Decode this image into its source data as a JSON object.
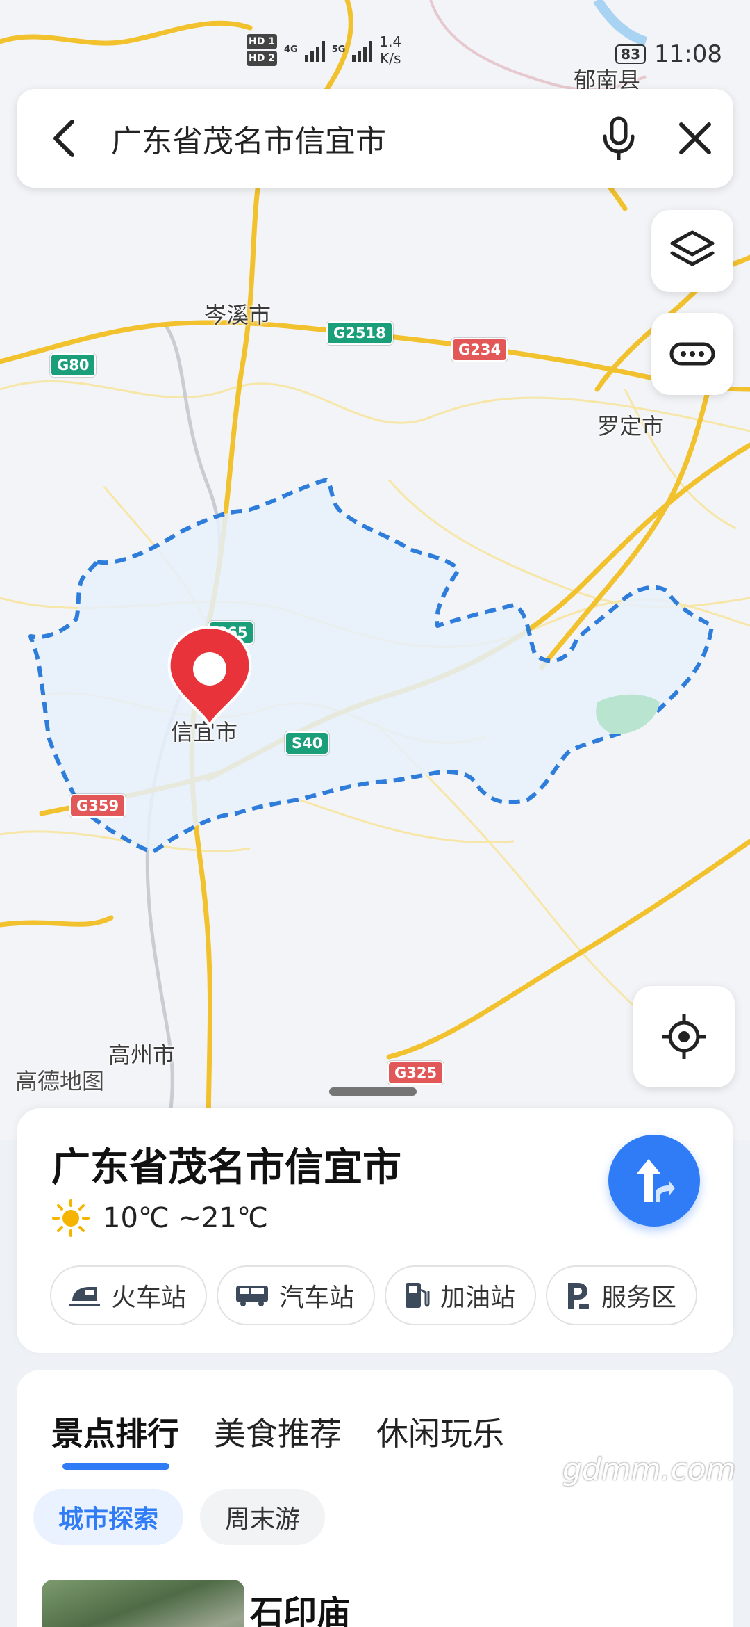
{
  "status_bar": {
    "hd1": "HD 1",
    "hd2": "HD 2",
    "net1": "4G",
    "net2": "5G",
    "speed_value": "1.4",
    "speed_unit": "K/s",
    "battery": "83",
    "time": "11:08"
  },
  "search": {
    "query": "广东省茂名市信宜市",
    "back_icon": "back-arrow-icon",
    "mic_icon": "microphone-icon",
    "close_icon": "close-icon"
  },
  "map": {
    "places": {
      "yunan": "郁南县",
      "cenxi": "岑溪市",
      "luoding": "罗定市",
      "xinyi": "信宜市",
      "gaozhou": "高州市"
    },
    "roads": {
      "g2518": "G2518",
      "g234": "G234",
      "g80": "G80",
      "g65": "G65",
      "s40": "S40",
      "g359": "G359",
      "g325": "G325"
    },
    "provider_logo": "高德地图",
    "layers_icon": "layers-icon",
    "more_icon": "more-icon",
    "locate_icon": "locate-icon",
    "marker_icon": "location-pin-icon"
  },
  "info_card": {
    "title": "广东省茂名市信宜市",
    "weather_icon": "sun-icon",
    "temperature": "10℃ ~21℃",
    "navigate_icon": "navigate-icon",
    "chips": [
      {
        "label": "火车站",
        "icon": "train-icon"
      },
      {
        "label": "汽车站",
        "icon": "bus-icon"
      },
      {
        "label": "加油站",
        "icon": "gas-station-icon"
      },
      {
        "label": "服务区",
        "icon": "service-area-icon"
      }
    ]
  },
  "explore": {
    "tabs": [
      "景点排行",
      "美食推荐",
      "休闲玩乐"
    ],
    "active_tab": 0,
    "subtabs": [
      "城市探索",
      "周末游"
    ],
    "active_subtab": 0,
    "first_item": {
      "name": "石印庙"
    }
  },
  "watermark": "gdmm.com",
  "colors": {
    "accent": "#2f7cf6",
    "marker": "#e8333a",
    "boundary": "#2f7ddb",
    "road_major": "#f2c12e",
    "road_green_label": "#1b9f7a",
    "road_red_label": "#e25858"
  }
}
